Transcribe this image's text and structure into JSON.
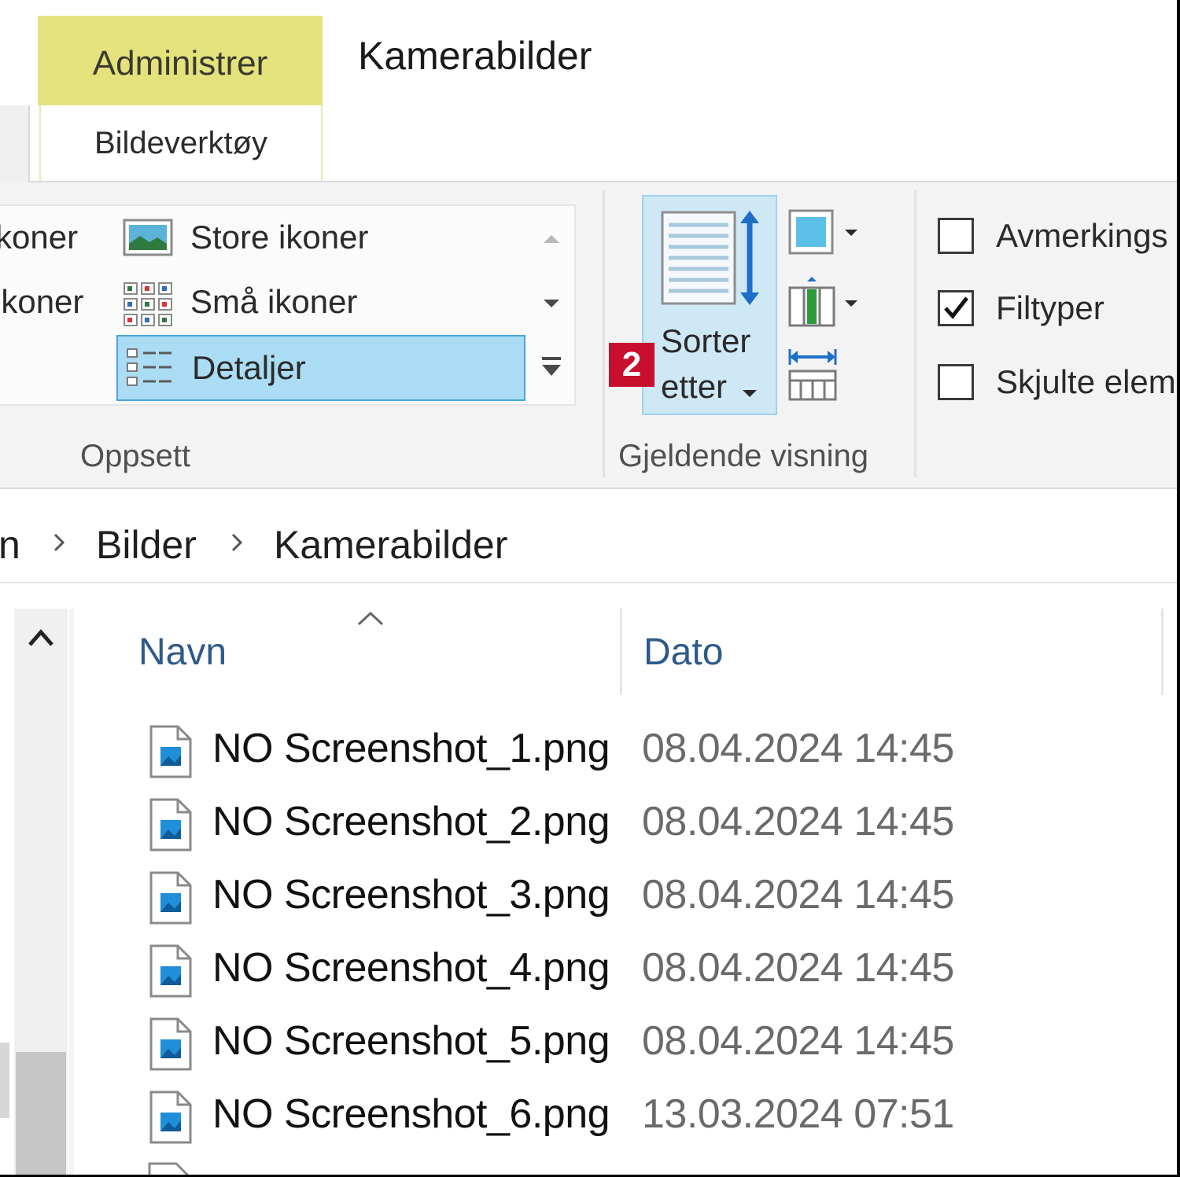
{
  "title_area": {
    "context_tab_group": "Administrer",
    "window_title": "Kamerabilder",
    "context_tab": "Bildeverktøy"
  },
  "ribbon": {
    "layout_group": {
      "label": "Oppsett",
      "items": [
        {
          "label": "koner",
          "icon": "extra-large-icons-icon"
        },
        {
          "label": "Store ikoner",
          "icon": "large-icons-icon"
        },
        {
          "label": "ikoner",
          "icon": "medium-icons-icon"
        },
        {
          "label": "Små ikoner",
          "icon": "small-icons-icon"
        },
        {
          "label": "Detaljer",
          "icon": "details-icon",
          "selected": true
        }
      ]
    },
    "current_view_group": {
      "label": "Gjeldende visning",
      "sort_button": {
        "line1": "Sorter",
        "line2": "etter"
      },
      "step_badge": "2"
    },
    "show_hide_group": {
      "options": [
        {
          "label": "Avmerkings",
          "checked": false
        },
        {
          "label": "Filtyper",
          "checked": true
        },
        {
          "label": "Skjulte elem",
          "checked": false
        }
      ]
    }
  },
  "address_bar": {
    "crumbs": [
      "n",
      "Bilder",
      "Kamerabilder"
    ]
  },
  "file_list": {
    "columns": {
      "name": "Navn",
      "date": "Dato"
    },
    "sort_column": "Navn",
    "rows": [
      {
        "name": "NO Screenshot_1.png",
        "date": "08.04.2024 14:45"
      },
      {
        "name": "NO Screenshot_2.png",
        "date": "08.04.2024 14:45"
      },
      {
        "name": "NO Screenshot_3.png",
        "date": "08.04.2024 14:45"
      },
      {
        "name": "NO Screenshot_4.png",
        "date": "08.04.2024 14:45"
      },
      {
        "name": "NO Screenshot_5.png",
        "date": "08.04.2024 14:45"
      },
      {
        "name": "NO Screenshot_6.png",
        "date": "13.03.2024 07:51"
      }
    ]
  },
  "colors": {
    "context_tab": "#e3e27d",
    "selected_item": "#aadcf3",
    "selected_border": "#4aa3df",
    "badge": "#c8102e",
    "header_text": "#2e5a8a"
  }
}
